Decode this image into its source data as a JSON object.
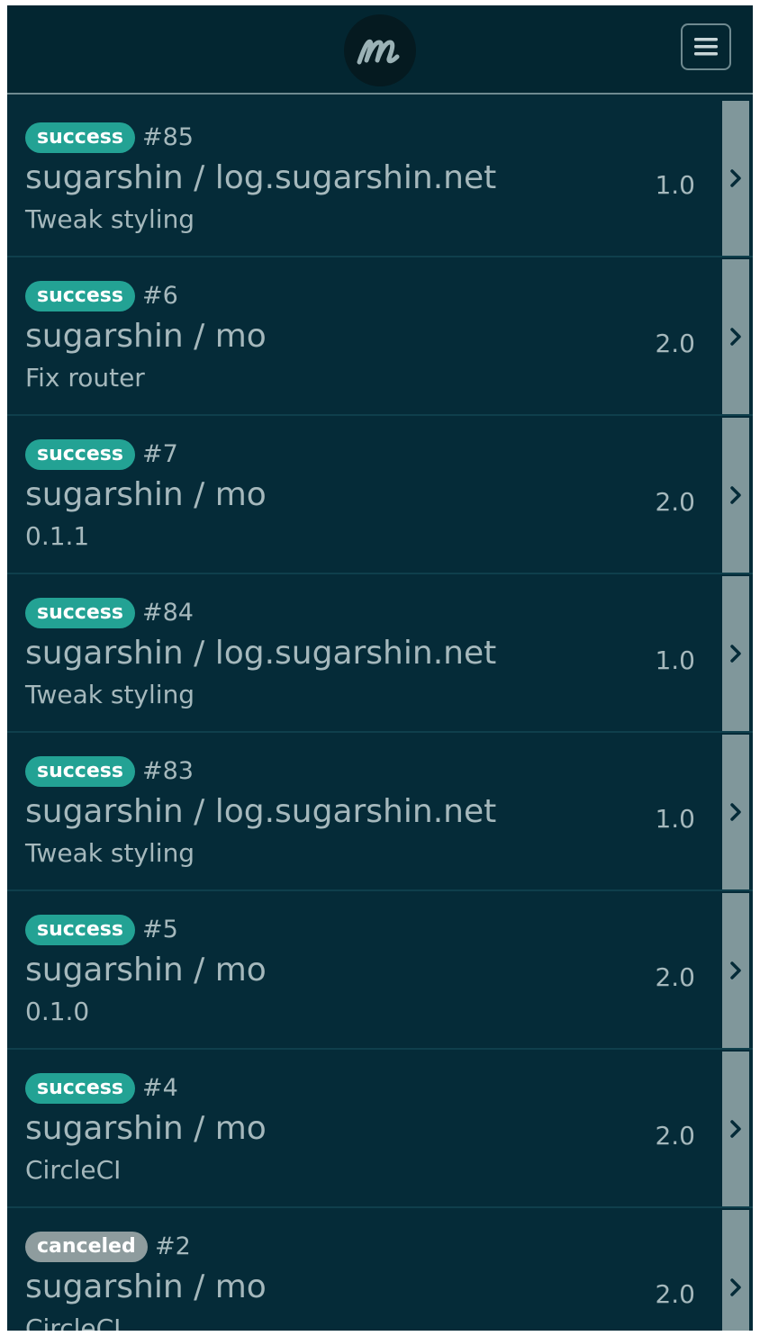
{
  "app": {
    "logo_letter": "m",
    "menu_icon": "hamburger-icon"
  },
  "colors": {
    "background": "#052b38",
    "navbar": "#032631",
    "success": "#23a294",
    "canceled": "#8e9c9e",
    "text": "#a5b8bc",
    "chevron_bar": "#80979b"
  },
  "builds": [
    {
      "status": "success",
      "number": "#85",
      "repo": "sugarshin / log.sugarshin.net",
      "message": "Tweak styling",
      "version": "1.0"
    },
    {
      "status": "success",
      "number": "#6",
      "repo": "sugarshin / mo",
      "message": "Fix router",
      "version": "2.0"
    },
    {
      "status": "success",
      "number": "#7",
      "repo": "sugarshin / mo",
      "message": "0.1.1",
      "version": "2.0"
    },
    {
      "status": "success",
      "number": "#84",
      "repo": "sugarshin / log.sugarshin.net",
      "message": "Tweak styling",
      "version": "1.0"
    },
    {
      "status": "success",
      "number": "#83",
      "repo": "sugarshin / log.sugarshin.net",
      "message": "Tweak styling",
      "version": "1.0"
    },
    {
      "status": "success",
      "number": "#5",
      "repo": "sugarshin / mo",
      "message": "0.1.0",
      "version": "2.0"
    },
    {
      "status": "success",
      "number": "#4",
      "repo": "sugarshin / mo",
      "message": "CircleCI",
      "version": "2.0"
    },
    {
      "status": "canceled",
      "number": "#2",
      "repo": "sugarshin / mo",
      "message": "CircleCI",
      "version": "2.0"
    }
  ]
}
